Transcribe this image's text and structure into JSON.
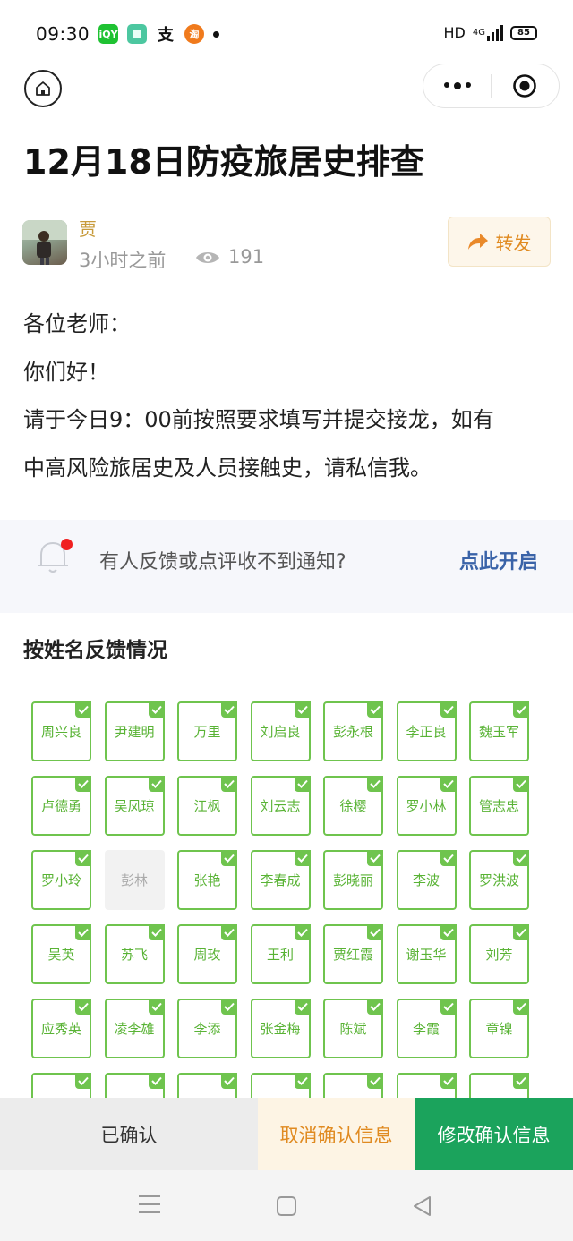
{
  "status_bar": {
    "time": "09:30",
    "apps": [
      {
        "icon": "iqiyi-icon",
        "label": "iQY",
        "color": "#1fc232"
      },
      {
        "icon": "app-green-square-icon",
        "label": "",
        "color": "#4cc7a0"
      },
      {
        "icon": "alipay-icon",
        "label": "支",
        "color": "#ffffff"
      },
      {
        "icon": "taobao-icon",
        "label": "淘",
        "color": "#f07a1c"
      }
    ],
    "network": "HD",
    "network_type": "4G",
    "battery": "85"
  },
  "header": {
    "title": "12月18日防疫旅居史排查"
  },
  "author": {
    "name": "贾",
    "time": "3小时之前",
    "views": "191",
    "forward_label": "转发"
  },
  "content": {
    "lines": [
      "各位老师：",
      "你们好！",
      "请于今日9：00前按照要求填写并提交接龙，如有",
      "中高风险旅居史及人员接触史，请私信我。"
    ]
  },
  "notice": {
    "text": "有人反馈或点评收不到通知?",
    "link": "点此开启"
  },
  "feedback": {
    "title": "按姓名反馈情况",
    "names": [
      {
        "name": "周兴良",
        "checked": true
      },
      {
        "name": "尹建明",
        "checked": true
      },
      {
        "name": "万里",
        "checked": true
      },
      {
        "name": "刘启良",
        "checked": true
      },
      {
        "name": "彭永根",
        "checked": true
      },
      {
        "name": "李正良",
        "checked": true
      },
      {
        "name": "魏玉军",
        "checked": true
      },
      {
        "name": "卢德勇",
        "checked": true
      },
      {
        "name": "吴凤琼",
        "checked": true
      },
      {
        "name": "江枫",
        "checked": true
      },
      {
        "name": "刘云志",
        "checked": true
      },
      {
        "name": "徐樱",
        "checked": true
      },
      {
        "name": "罗小林",
        "checked": true
      },
      {
        "name": "管志忠",
        "checked": true
      },
      {
        "name": "罗小玲",
        "checked": true
      },
      {
        "name": "彭林",
        "checked": false
      },
      {
        "name": "张艳",
        "checked": true
      },
      {
        "name": "李春成",
        "checked": true
      },
      {
        "name": "彭晓丽",
        "checked": true
      },
      {
        "name": "李波",
        "checked": true
      },
      {
        "name": "罗洪波",
        "checked": true
      },
      {
        "name": "吴英",
        "checked": true
      },
      {
        "name": "苏飞",
        "checked": true
      },
      {
        "name": "周玫",
        "checked": true
      },
      {
        "name": "王利",
        "checked": true
      },
      {
        "name": "贾红霞",
        "checked": true
      },
      {
        "name": "谢玉华",
        "checked": true
      },
      {
        "name": "刘芳",
        "checked": true
      },
      {
        "name": "应秀英",
        "checked": true
      },
      {
        "name": "凌李雄",
        "checked": true
      },
      {
        "name": "李添",
        "checked": true
      },
      {
        "name": "张金梅",
        "checked": true
      },
      {
        "name": "陈斌",
        "checked": true
      },
      {
        "name": "李霞",
        "checked": true
      },
      {
        "name": "章镍",
        "checked": true
      },
      {
        "name": "",
        "checked": true
      },
      {
        "name": "",
        "checked": true
      },
      {
        "name": "",
        "checked": true
      },
      {
        "name": "",
        "checked": true
      },
      {
        "name": "",
        "checked": true
      },
      {
        "name": "",
        "checked": true
      },
      {
        "name": "",
        "checked": true
      }
    ]
  },
  "actions": {
    "confirmed": "已确认",
    "cancel": "取消确认信息",
    "modify": "修改确认信息"
  },
  "colors": {
    "accent_green": "#6fc44e",
    "primary_green": "#1ba35c",
    "orange": "#e08a20",
    "link_blue": "#3a63a8"
  }
}
